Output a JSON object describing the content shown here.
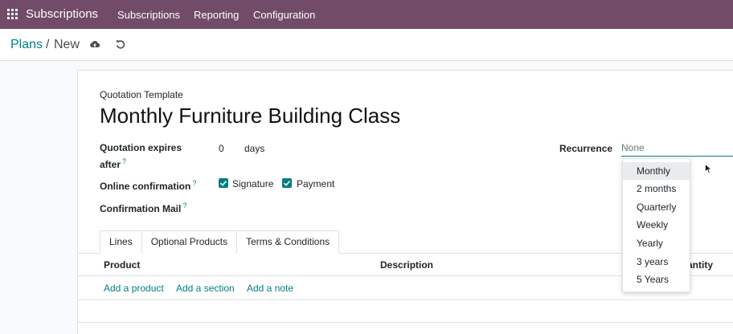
{
  "topbar": {
    "apps_icon": "grid-icon",
    "brand": "Subscriptions",
    "menu": [
      "Subscriptions",
      "Reporting",
      "Configuration"
    ],
    "color": "#714b67"
  },
  "breadcrumb": {
    "parent": "Plans",
    "separator": "/",
    "current": "New",
    "save_icon": "cloud-upload-icon",
    "discard_icon": "undo-icon"
  },
  "form": {
    "template_label": "Quotation Template",
    "title": "Monthly Furniture Building Class",
    "expires_label_line1": "Quotation expires",
    "expires_label_line2": "after",
    "help_mark": "?",
    "expires_value": "0",
    "expires_unit": "days",
    "online_confirmation_label": "Online confirmation",
    "signature_label": "Signature",
    "signature_checked": true,
    "payment_label": "Payment",
    "payment_checked": true,
    "confirmation_mail_label": "Confirmation Mail",
    "recurrence_label": "Recurrence",
    "recurrence_placeholder": "None"
  },
  "tabs": [
    {
      "label": "Lines",
      "active": true
    },
    {
      "label": "Optional Products",
      "active": false
    },
    {
      "label": "Terms & Conditions",
      "active": false
    }
  ],
  "table": {
    "headers": [
      "Product",
      "Description",
      "antity"
    ],
    "actions": [
      "Add a product",
      "Add a section",
      "Add a note"
    ]
  },
  "recurrence_dropdown": {
    "options": [
      "Monthly",
      "2 months",
      "Quarterly",
      "Weekly",
      "Yearly",
      "3 years",
      "5 Years"
    ],
    "highlighted": "Monthly"
  },
  "accent_color": "#017e84"
}
